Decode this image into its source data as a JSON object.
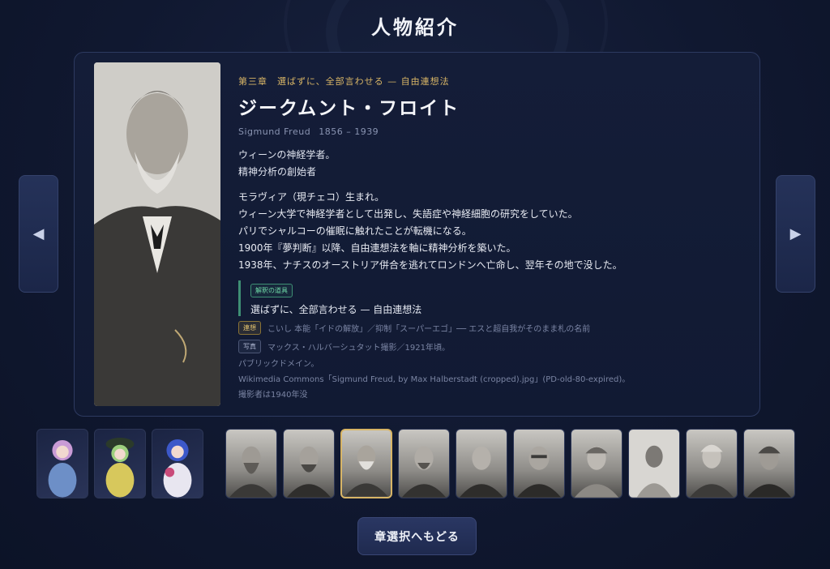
{
  "page_title": "人物紹介",
  "nav": {
    "prev_icon": "left-triangle-icon",
    "next_icon": "right-triangle-icon",
    "prev_symbol": "◀",
    "next_symbol": "▶"
  },
  "person": {
    "chapter": "第三章　選ばずに、全部言わせる — 自由連想法",
    "name_jp": "ジークムント・フロイト",
    "name_en": "Sigmund Freud",
    "dates": "1856 – 1939",
    "intro": [
      "ウィーンの神経学者。",
      "精神分析の創始者"
    ],
    "bio": [
      "モラヴィア（現チェコ）生まれ。",
      "ウィーン大学で神経学者として出発し、失語症や神経細胞の研究をしていた。",
      "パリでシャルコーの催眠に触れたことが転機になる。",
      "1900年『夢判断』以降、自由連想法を軸に精神分析を築いた。",
      "1938年、ナチスのオーストリア併合を逃れてロンドンへ亡命し、翌年その地で没した。"
    ],
    "tool_badge": "解釈の道具",
    "tool_text": "選ばずに、全部言わせる — 自由連想法",
    "related_tag": "連想",
    "related_text": "こいし 本能「イドの解放」／抑制「スーパーエゴ」── エスと超自我がそのまま札の名前",
    "photo_tag": "写真",
    "photo_lines": [
      "マックス・ハルバーシュタット撮影／1921年頃。",
      "パブリックドメイン。",
      "Wikimedia Commons「Sigmund Freud, by Max Halberstadt (cropped).jpg」(PD-old-80-expired)。",
      "撮影者は1940年没"
    ]
  },
  "thumbnails": {
    "characters": [
      "character-thumb-1",
      "character-thumb-2",
      "character-thumb-3"
    ],
    "people": [
      "person-thumb-1",
      "person-thumb-2",
      "person-thumb-3",
      "person-thumb-4",
      "person-thumb-5",
      "person-thumb-6",
      "person-thumb-7",
      "person-thumb-8",
      "person-thumb-9",
      "person-thumb-10"
    ],
    "active_index": 2
  },
  "back_button": "章選択へもどる",
  "colors": {
    "accent_gold": "#d8b566",
    "accent_green": "#3e8f74",
    "background": "#101830"
  }
}
